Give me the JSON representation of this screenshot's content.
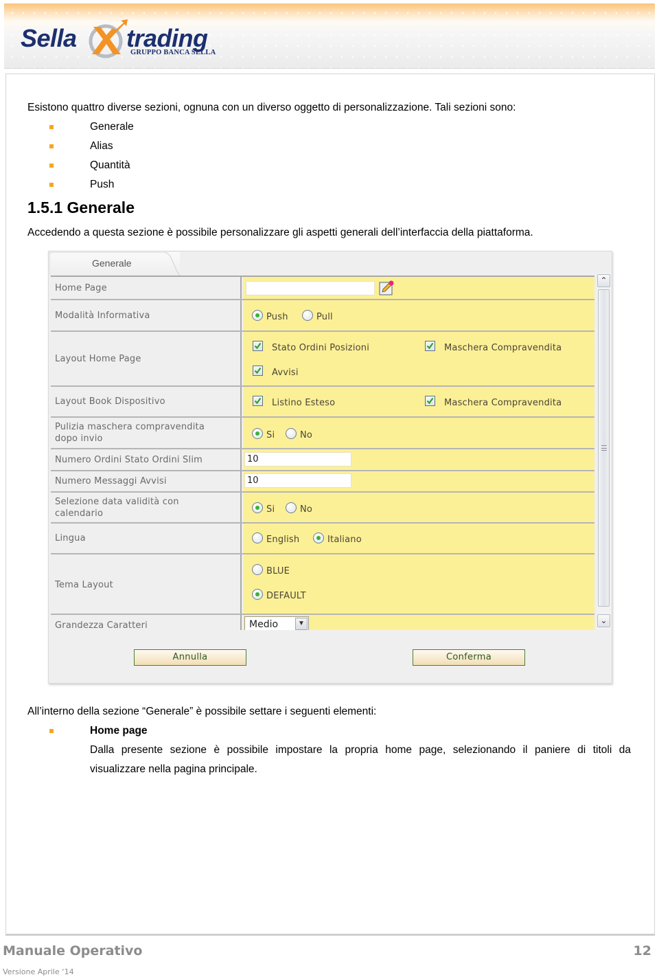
{
  "header": {
    "logo": {
      "left": "Sella",
      "right": "trading",
      "subtitle": "GRUPPO BANCA SELLA",
      "brand_color": "#1c2f6e",
      "accent_color": "#f39325"
    }
  },
  "intro": {
    "paragraph": "Esistono quattro diverse sezioni, ognuna con un diverso oggetto di personalizzazione. Tali sezioni sono:",
    "sections": [
      "Generale",
      "Alias",
      "Quantità",
      "Push"
    ]
  },
  "section": {
    "heading": "1.5.1 Generale",
    "paragraph": "Accedendo a questa sezione è possibile personalizzare gli aspetti generali dell’interfaccia della piattaforma."
  },
  "panel": {
    "tab_label": "Generale",
    "rows": {
      "home_page": {
        "label": "Home Page",
        "value": "",
        "edit_icon": "pencil-edit-icon"
      },
      "modalita": {
        "label": "Modalità Informativa",
        "options": [
          "Push",
          "Pull"
        ],
        "selected": "Push"
      },
      "layout_home": {
        "label": "Layout Home Page",
        "checks": [
          {
            "label": "Stato Ordini  Posizioni",
            "checked": true
          },
          {
            "label": "Maschera Compravendita",
            "checked": true
          },
          {
            "label": "Avvisi",
            "checked": true
          }
        ]
      },
      "layout_book": {
        "label": "Layout Book Dispositivo",
        "checks": [
          {
            "label": "Listino Esteso",
            "checked": true
          },
          {
            "label": "Maschera Compravendita",
            "checked": true
          }
        ]
      },
      "pulizia": {
        "label_line1": "Pulizia maschera compravendita",
        "label_line2": "dopo invio",
        "options": [
          "Si",
          "No"
        ],
        "selected": "Si"
      },
      "num_ordini": {
        "label": "Numero Ordini Stato Ordini Slim",
        "value": "10"
      },
      "num_messaggi": {
        "label": "Numero Messaggi Avvisi",
        "value": "10"
      },
      "selezione_data": {
        "label_line1": "Selezione data validità con",
        "label_line2": "calendario",
        "options": [
          "Si",
          "No"
        ],
        "selected": "Si"
      },
      "lingua": {
        "label": "Lingua",
        "options": [
          "English",
          "Italiano"
        ],
        "selected": "Italiano"
      },
      "tema": {
        "label": "Tema Layout",
        "options": [
          "BLUE",
          "DEFAULT"
        ],
        "selected": "DEFAULT"
      },
      "grandezza": {
        "label": "Grandezza Caratteri",
        "selected": "Medio"
      }
    },
    "buttons": {
      "cancel": "Annulla",
      "confirm": "Conferma"
    },
    "scrollbar": {
      "up": "^",
      "down": "v"
    }
  },
  "details": {
    "paragraph": "All’interno della sezione “Generale” è possibile settare i seguenti elementi:",
    "items": [
      {
        "title": "Home page",
        "line1": "Dalla presente sezione è possibile impostare la propria home page, selezionando il paniere di titoli da",
        "line2": "visualizzare nella pagina principale."
      }
    ]
  },
  "footer": {
    "title": "Manuale Operativo",
    "page": "12",
    "version": "Versione Aprile ‘14"
  }
}
